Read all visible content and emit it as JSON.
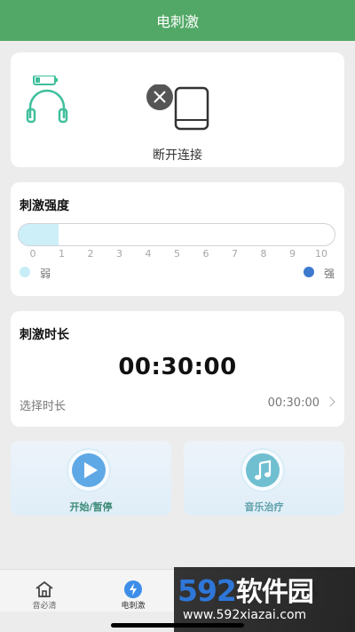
{
  "header": {
    "title": "电刺激"
  },
  "device_card": {
    "status_text": "断开连接",
    "icons": [
      "headset-battery-icon",
      "disconnect-close-icon",
      "tablet-icon"
    ],
    "colors": {
      "headset": "#3fbf9c",
      "device": "#333333"
    }
  },
  "intensity_card": {
    "title": "刺激强度",
    "scale": [
      "0",
      "1",
      "2",
      "3",
      "4",
      "5",
      "6",
      "7",
      "8",
      "9",
      "10"
    ],
    "value": 0.5,
    "weak_label": "弱",
    "strong_label": "强",
    "colors": {
      "weak": "#c7eef7",
      "strong": "#3c79cf"
    }
  },
  "duration_card": {
    "title": "刺激时长",
    "time": "00:30:00",
    "select_label": "选择时长",
    "select_value": "00:30:00"
  },
  "actions": {
    "start_pause": "开始/暂停",
    "music_therapy": "音乐治疗"
  },
  "tabbar": {
    "tabs": [
      {
        "label": "音必清",
        "icon": "home-icon"
      },
      {
        "label": "电刺激",
        "icon": "lightning-icon"
      },
      {
        "label": "",
        "icon": "tab-icon-3"
      },
      {
        "label": "",
        "icon": "tab-icon-4"
      }
    ]
  },
  "watermark": {
    "line1_number": "592",
    "line1_text": "软件园",
    "line2": "www.592xiazai.com"
  }
}
